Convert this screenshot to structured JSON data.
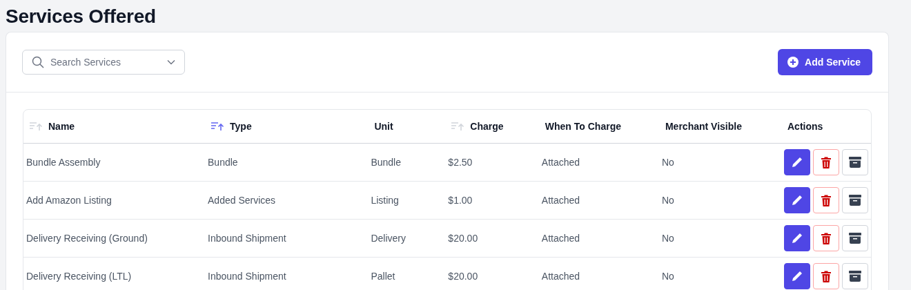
{
  "page_title": "Services Offered",
  "search": {
    "placeholder": "Search Services"
  },
  "add_button": {
    "label": "Add Service"
  },
  "table": {
    "columns": [
      {
        "label": "Name",
        "kind": "sortable",
        "selected": false
      },
      {
        "label": "Type",
        "kind": "sortable",
        "selected": true
      },
      {
        "label": "Unit",
        "kind": "plain"
      },
      {
        "label": "Charge",
        "kind": "sortable",
        "selected": false
      },
      {
        "label": "When To Charge",
        "kind": "plain"
      },
      {
        "label": "Merchant Visible",
        "kind": "plain"
      },
      {
        "label": "Actions",
        "kind": "plain"
      }
    ],
    "rows": [
      {
        "name": "Bundle Assembly",
        "type": "Bundle",
        "unit": "Bundle",
        "charge": "$2.50",
        "when": "Attached",
        "visible": "No"
      },
      {
        "name": "Add Amazon Listing",
        "type": "Added Services",
        "unit": "Listing",
        "charge": "$1.00",
        "when": "Attached",
        "visible": "No"
      },
      {
        "name": "Delivery Receiving (Ground)",
        "type": "Inbound Shipment",
        "unit": "Delivery",
        "charge": "$20.00",
        "when": "Attached",
        "visible": "No"
      },
      {
        "name": "Delivery Receiving (LTL)",
        "type": "Inbound Shipment",
        "unit": "Pallet",
        "charge": "$20.00",
        "when": "Attached",
        "visible": "No"
      }
    ]
  }
}
